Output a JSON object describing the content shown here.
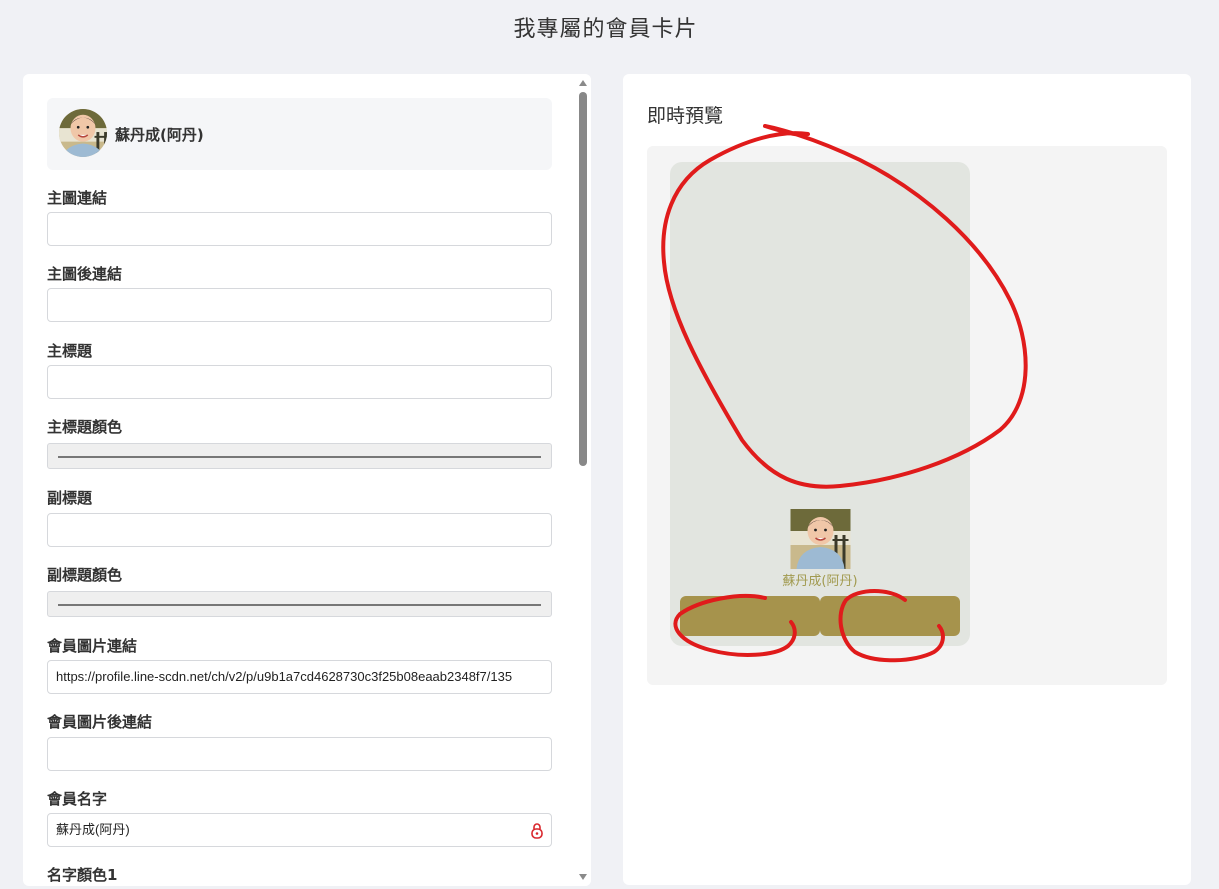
{
  "page": {
    "title": "我專屬的會員卡片"
  },
  "profile": {
    "name": "蘇丹成(阿丹)"
  },
  "form": {
    "fields": [
      {
        "label": "主圖連結",
        "value": ""
      },
      {
        "label": "主圖後連結",
        "value": ""
      },
      {
        "label": "主標題",
        "value": ""
      },
      {
        "label": "主標題顏色"
      },
      {
        "label": "副標題",
        "value": ""
      },
      {
        "label": "副標題顏色"
      },
      {
        "label": "會員圖片連結",
        "value": "https://profile.line-scdn.net/ch/v2/p/u9b1a7cd4628730c3f25b08eaab2348f7/135"
      },
      {
        "label": "會員圖片後連結",
        "value": ""
      },
      {
        "label": "會員名字",
        "value": "蘇丹成(阿丹)"
      },
      {
        "label": "名字顏色1"
      }
    ]
  },
  "preview": {
    "title": "即時預覽",
    "card_name": "蘇丹成(阿丹)"
  },
  "colors": {
    "card_bg": "#e2e5e0",
    "button": "#a6934c",
    "name_text": "#a19a4f",
    "annotation": "#e01b1b"
  },
  "icons": [
    "lock-icon",
    "scroll-up-icon",
    "scroll-down-icon"
  ]
}
